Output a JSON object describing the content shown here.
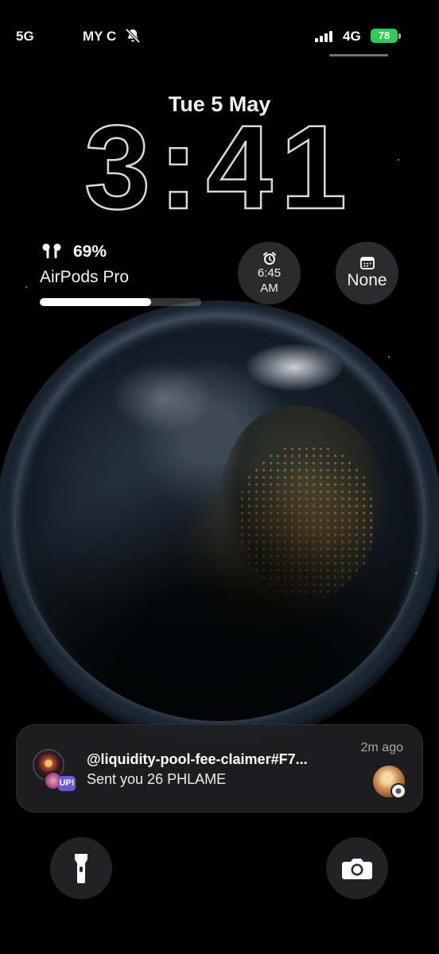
{
  "status_bar": {
    "carrier_left": "5G",
    "carrier_name": "MY C",
    "network": "4G",
    "battery_level": "78",
    "icons": [
      "bell-slash-icon",
      "signal-bars-icon",
      "battery-charging-icon"
    ]
  },
  "lockscreen": {
    "date": "Tue 5 May",
    "time": "3:41"
  },
  "widgets": {
    "airpods": {
      "percent_text": "69%",
      "device_name": "AirPods Pro",
      "level": 0.69,
      "icon": "airpods-icon"
    },
    "alarm": {
      "time": "6:45",
      "period": "AM",
      "icon": "alarm-clock-icon"
    },
    "calendar": {
      "text": "None",
      "icon": "calendar-icon"
    }
  },
  "notification": {
    "title": "@liquidity-pool-fee-claimer#F7...",
    "body": "Sent you 26 PHLAME",
    "timestamp": "2m ago",
    "badge": "UP!"
  },
  "bottom_buttons": {
    "left": "flashlight-icon",
    "right": "camera-icon"
  },
  "colors": {
    "background": "#000000",
    "battery": "#34c759",
    "badge": "#6a5ad6"
  }
}
